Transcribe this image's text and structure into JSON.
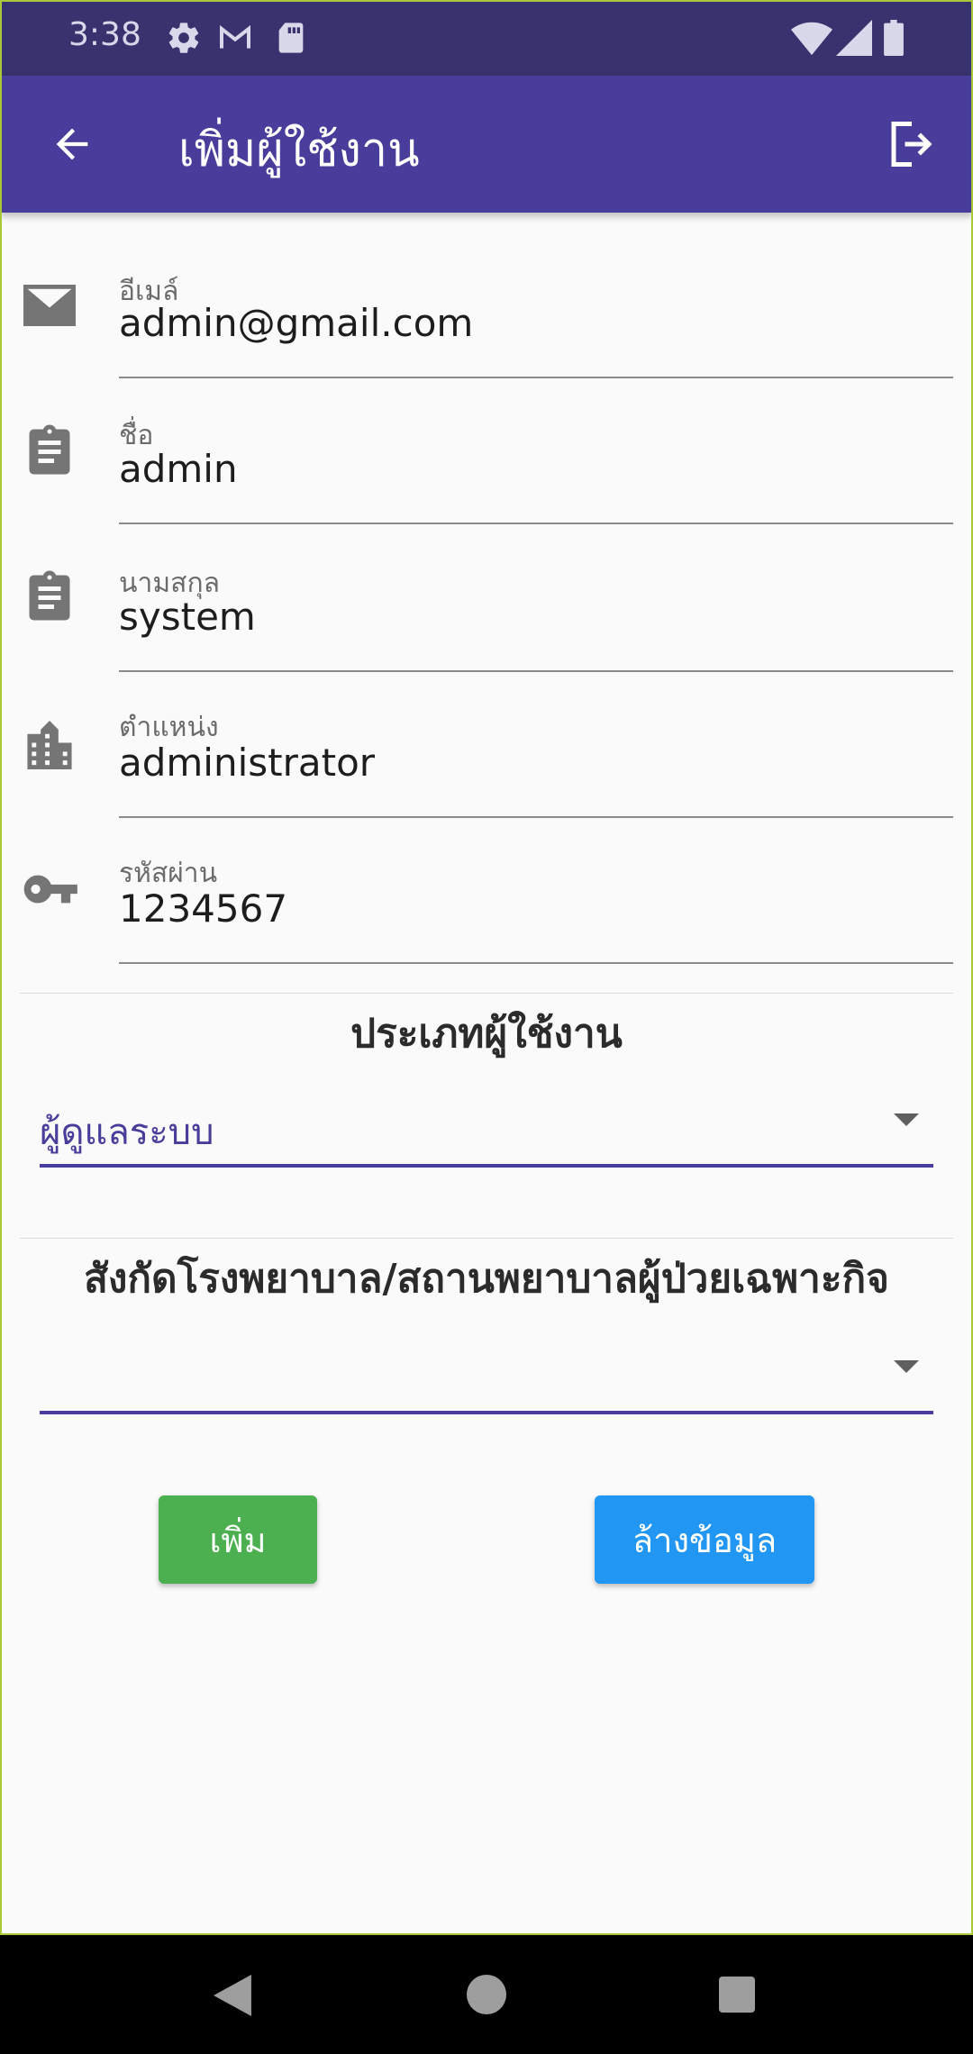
{
  "status_bar": {
    "time": "3:38",
    "left_icons": [
      "gear-icon",
      "gmail-icon",
      "sd-card-icon"
    ],
    "right_icons": [
      "wifi-icon",
      "signal-icon",
      "battery-icon"
    ]
  },
  "app_bar": {
    "title": "เพิ่มผู้ใช้งาน",
    "back_icon": "arrow-left-icon",
    "logout_icon": "logout-icon",
    "background": "#483d9a"
  },
  "fields": {
    "email": {
      "label": "อีเมล์",
      "value": "admin@gmail.com",
      "icon": "mail-icon"
    },
    "first_name": {
      "label": "ชื่อ",
      "value": "admin",
      "icon": "clipboard-icon"
    },
    "last_name": {
      "label": "นามสกุล",
      "value": "system",
      "icon": "clipboard-icon"
    },
    "position": {
      "label": "ตำแหน่ง",
      "value": "administrator",
      "icon": "building-icon"
    },
    "password": {
      "label": "รหัสผ่าน",
      "value": "1234567",
      "icon": "key-icon"
    }
  },
  "user_type": {
    "title": "ประเภทผู้ใช้งาน",
    "selected": "ผู้ดูแลระบบ"
  },
  "affiliation": {
    "title": "สังกัดโรงพยาบาล/สถานพยาบาลผู้ป่วยเฉพาะกิจ",
    "selected": ""
  },
  "buttons": {
    "add_label": "เพิ่ม",
    "add_color": "#4caf50",
    "clear_label": "ล้างข้อมูล",
    "clear_color": "#2196f3"
  },
  "nav_bar": {
    "icons": [
      "back-triangle-icon",
      "home-circle-icon",
      "recents-square-icon"
    ]
  }
}
